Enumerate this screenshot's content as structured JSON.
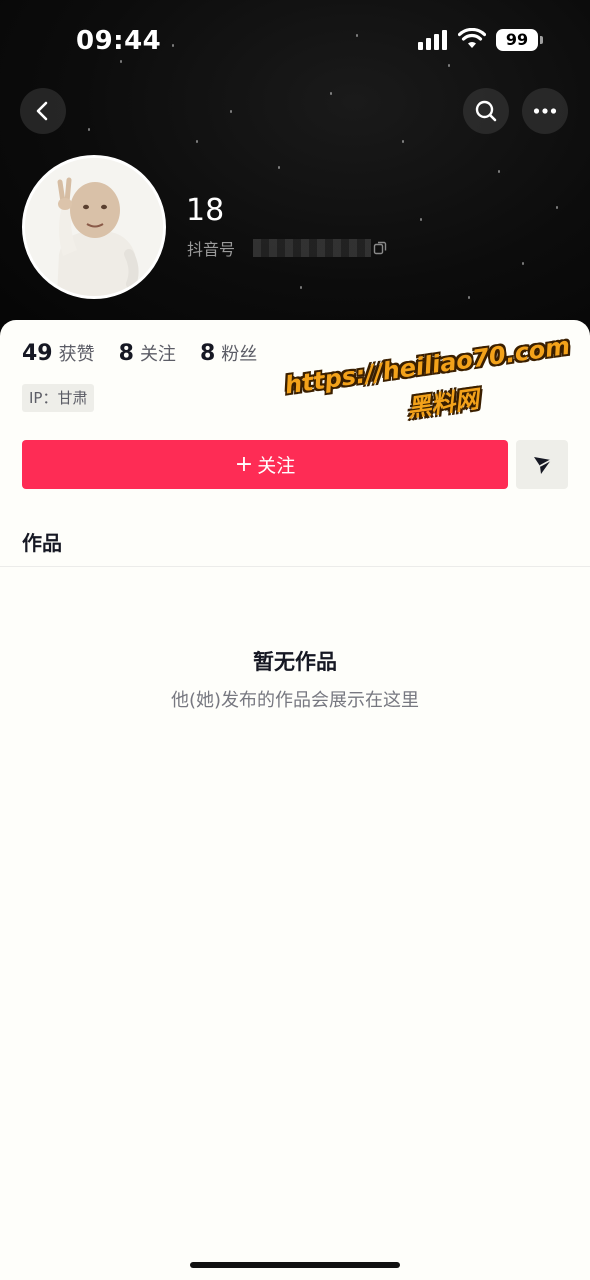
{
  "status_bar": {
    "time": "09:44",
    "battery": "99"
  },
  "profile": {
    "name": "18",
    "douyin_id_label": "抖音号",
    "stats": [
      {
        "value": "49",
        "label": "获赞"
      },
      {
        "value": "8",
        "label": "关注"
      },
      {
        "value": "8",
        "label": "粉丝"
      }
    ],
    "ip": "IP：甘肃"
  },
  "actions": {
    "follow_label": "关注",
    "follow_prefix": "+"
  },
  "tabs": {
    "works": "作品"
  },
  "empty_state": {
    "title": "暂无作品",
    "subtitle": "他(她)发布的作品会展示在这里"
  },
  "watermark": {
    "url": "https://heiliao70.com",
    "name": "黑料网"
  },
  "colors": {
    "accent": "#fe2c55",
    "header_bg": "#0c0c0c",
    "panel_bg": "#fefefa",
    "watermark": "#f3a21a"
  },
  "icons": {
    "back": "chevron-left-icon",
    "search": "search-icon",
    "more": "more-dots-icon",
    "share": "send-arrow-icon",
    "copy": "copy-icon",
    "signal": "signal-icon",
    "wifi": "wifi-icon"
  }
}
